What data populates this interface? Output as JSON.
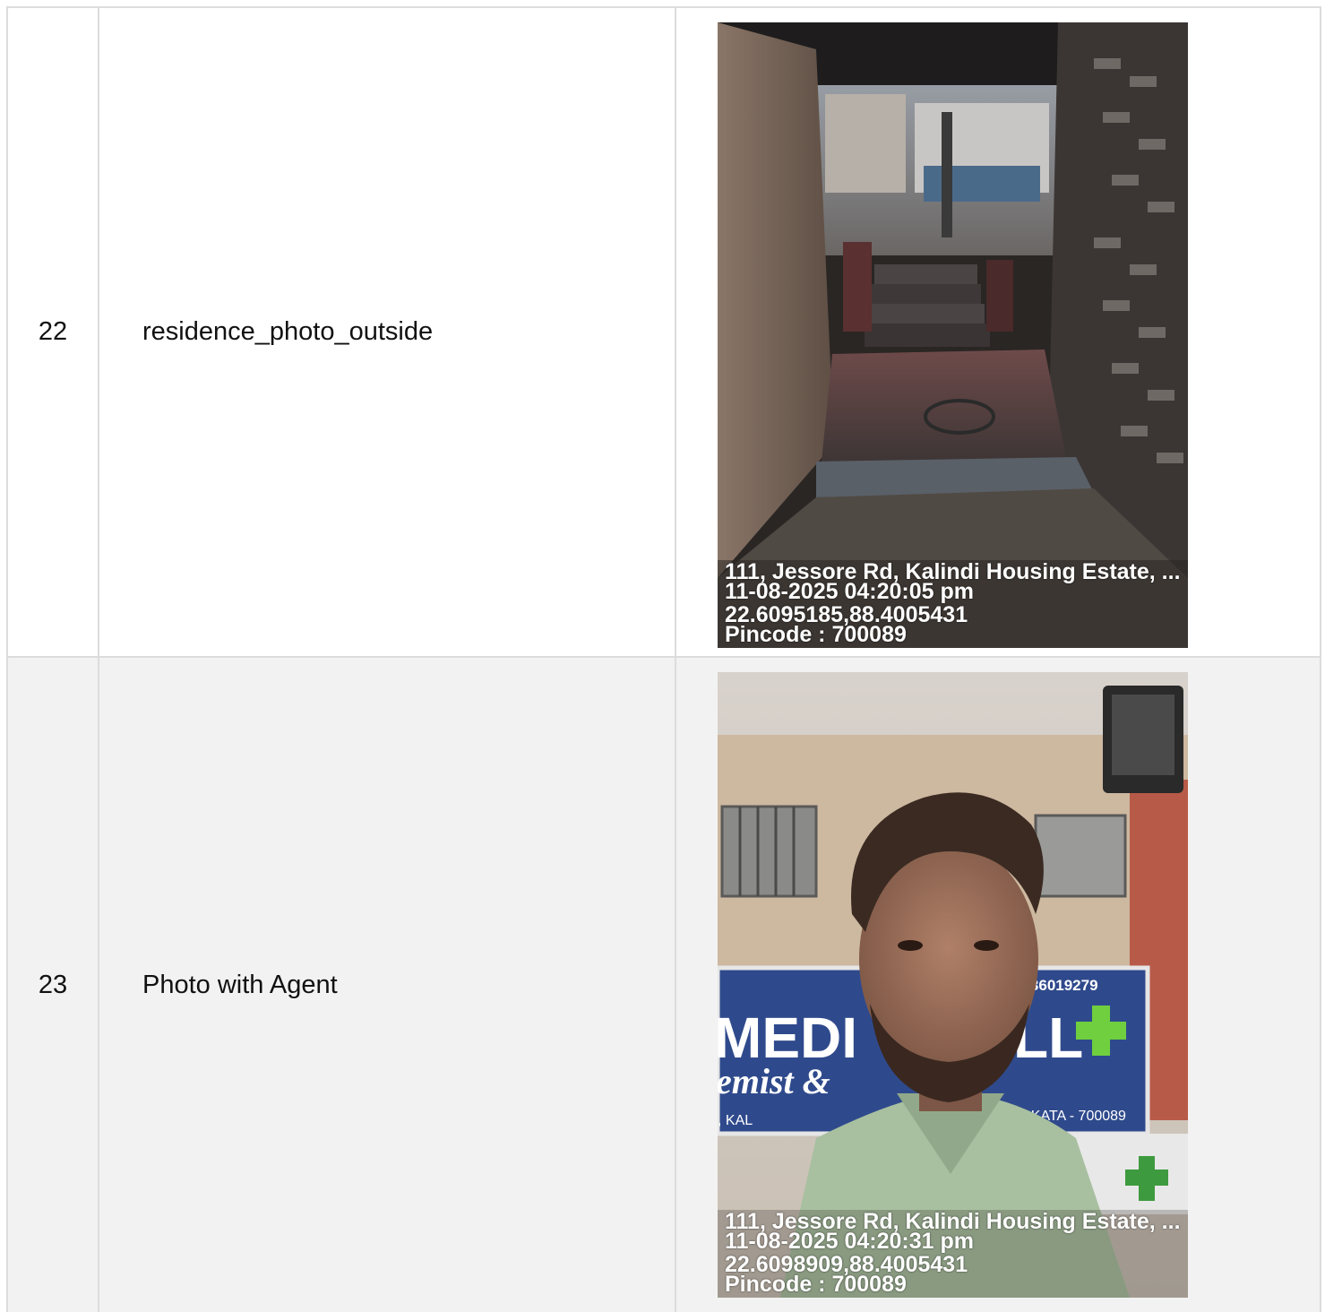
{
  "rows": [
    {
      "number": "22",
      "label": "residence_photo_outside",
      "photo": {
        "address": "111, Jessore Rd, Kalindi Housing Estate, ...",
        "timestamp": "11-08-2025 04:20:05 pm",
        "coordinates": "22.6095185,88.4005431",
        "pincode": "Pincode : 700089"
      }
    },
    {
      "number": "23",
      "label": "Photo with Agent",
      "photo": {
        "address": "111, Jessore Rd, Kalindi Housing Estate, ...",
        "timestamp": "11-08-2025 04:20:31 pm",
        "coordinates": "22.6098909,88.4005431",
        "pincode": "Pincode : 700089",
        "sign_phone": "9836019279",
        "sign_line1": "MEDI",
        "sign_line1b": "LL",
        "sign_line2": "emist &",
        "sign_line3": "5, KOLKATA - 700089",
        "sign_line3b": ", KAL"
      }
    }
  ]
}
